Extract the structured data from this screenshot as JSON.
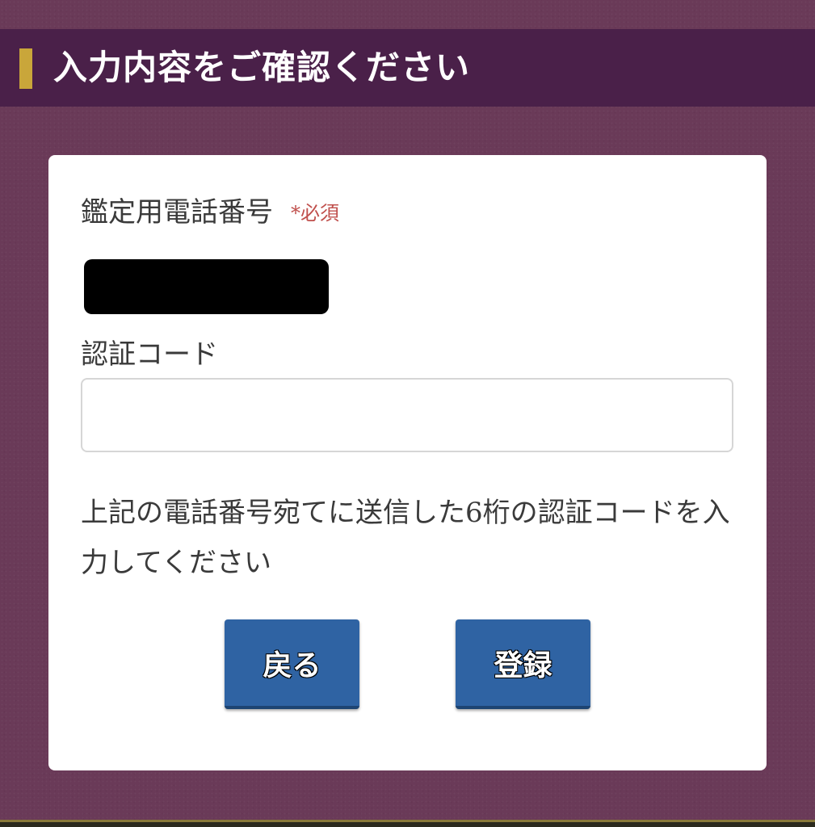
{
  "header": {
    "title": "入力内容をご確認ください"
  },
  "form": {
    "phone_label": "鑑定用電話番号",
    "required_mark": "*必須",
    "code_label": "認証コード",
    "code_value": "",
    "instruction": "上記の電話番号宛てに送信した6桁の認証コードを入力してください"
  },
  "buttons": {
    "back_label": "戻る",
    "register_label": "登録"
  },
  "colors": {
    "background": "#6a3a58",
    "header_bar": "#4a2049",
    "header_accent": "#c9a63a",
    "button": "#2f63a3",
    "required": "#c0504d"
  }
}
